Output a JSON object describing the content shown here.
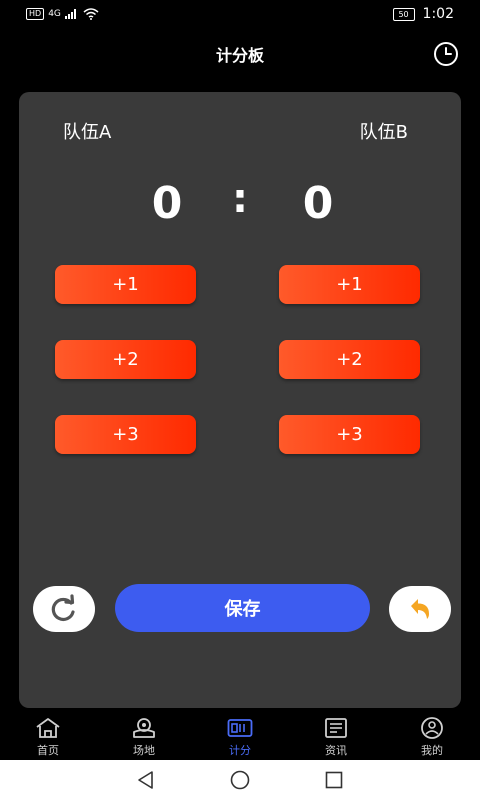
{
  "status_bar": {
    "network_hd": "HD",
    "network_type": "4G",
    "battery": "50",
    "time": "1:02"
  },
  "header": {
    "title": "计分板"
  },
  "scoreboard": {
    "team_a": "队伍A",
    "team_b": "队伍B",
    "score_a": "0",
    "score_b": "0",
    "separator": ":",
    "buttons": {
      "plus1": "+1",
      "plus2": "+2",
      "plus3": "+3"
    },
    "save_label": "保存"
  },
  "bottom_nav": {
    "items": [
      {
        "label": "首页",
        "icon": "home-icon"
      },
      {
        "label": "场地",
        "icon": "venue-icon"
      },
      {
        "label": "计分",
        "icon": "scoreboard-icon",
        "active": true
      },
      {
        "label": "资讯",
        "icon": "news-icon"
      },
      {
        "label": "我的",
        "icon": "profile-icon"
      }
    ]
  },
  "colors": {
    "accent_orange": "#ff3a10",
    "save_blue": "#3d5cf0",
    "active_nav": "#4a6cf7",
    "card_bg": "#3a3a3a",
    "undo_orange": "#f5a623"
  }
}
